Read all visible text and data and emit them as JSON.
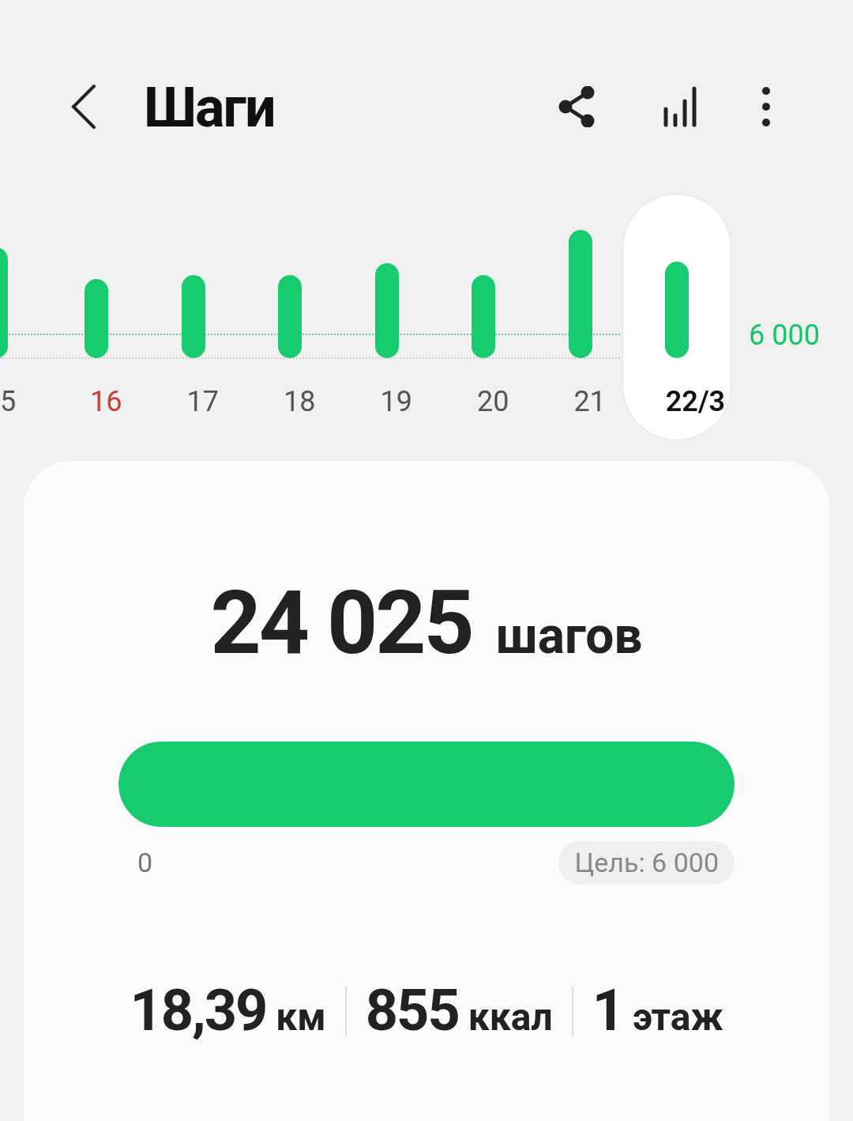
{
  "header": {
    "title": "Шаги"
  },
  "days": [
    {
      "label": "5",
      "color": "#555555",
      "selected": false
    },
    {
      "label": "16",
      "color": "#d23b36",
      "selected": false
    },
    {
      "label": "17",
      "color": "#555555",
      "selected": false
    },
    {
      "label": "18",
      "color": "#555555",
      "selected": false
    },
    {
      "label": "19",
      "color": "#555555",
      "selected": false
    },
    {
      "label": "20",
      "color": "#555555",
      "selected": false
    },
    {
      "label": "21",
      "color": "#555555",
      "selected": false
    },
    {
      "label": "22/3",
      "color": "#111111",
      "selected": true
    }
  ],
  "goal_label": "6 000",
  "summary": {
    "steps": "24 025",
    "unit": "шагов",
    "level": 1,
    "scale_min": "0",
    "goal": "Цель: 6 000"
  },
  "stats": [
    {
      "value": "18,39",
      "unit": "км"
    },
    {
      "value": "855",
      "unit": "ккал"
    },
    {
      "value": "1",
      "unit": "этаж"
    }
  ]
}
